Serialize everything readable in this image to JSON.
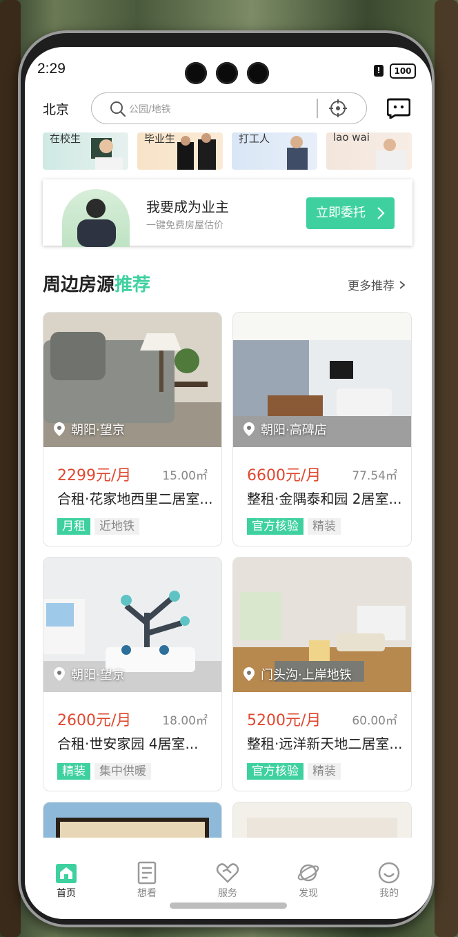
{
  "status": {
    "time": "2:29",
    "battery": "100"
  },
  "header": {
    "city": "北京",
    "search_placeholder": "公园/地铁"
  },
  "categories": [
    {
      "label": "在校生"
    },
    {
      "label": "毕业生"
    },
    {
      "label": "打工人"
    },
    {
      "label": "lao wai"
    }
  ],
  "owner_banner": {
    "title": "我要成为业主",
    "subtitle": "一键免费房屋估价",
    "button": "立即委托"
  },
  "section": {
    "title_main": "周边房源",
    "title_highlight": "推荐",
    "more": "更多推荐"
  },
  "listings": [
    {
      "location": "朝阳·望京",
      "price": "2299元/月",
      "area": "15.00㎡",
      "title": "合租·花家地西里二居室...",
      "tags": [
        "月租",
        "近地铁"
      ]
    },
    {
      "location": "朝阳·高碑店",
      "price": "6600元/月",
      "area": "77.54㎡",
      "title": "整租·金隅泰和园 2居室...",
      "tags": [
        "官方核验",
        "精装"
      ]
    },
    {
      "location": "朝阳·望京",
      "price": "2600元/月",
      "area": "18.00㎡",
      "title": "合租·世安家园 4居室...",
      "tags": [
        "精装",
        "集中供暖"
      ]
    },
    {
      "location": "门头沟·上岸地铁",
      "price": "5200元/月",
      "area": "60.00㎡",
      "title": "整租·远洋新天地二居室...",
      "tags": [
        "官方核验",
        "精装"
      ]
    }
  ],
  "tabs": [
    {
      "label": "首页",
      "icon": "home-icon"
    },
    {
      "label": "想看",
      "icon": "document-icon"
    },
    {
      "label": "服务",
      "icon": "heart-handshake-icon"
    },
    {
      "label": "发现",
      "icon": "planet-icon"
    },
    {
      "label": "我的",
      "icon": "smile-icon"
    }
  ],
  "colors": {
    "accent": "#3ed19f",
    "price": "#e0482f"
  }
}
